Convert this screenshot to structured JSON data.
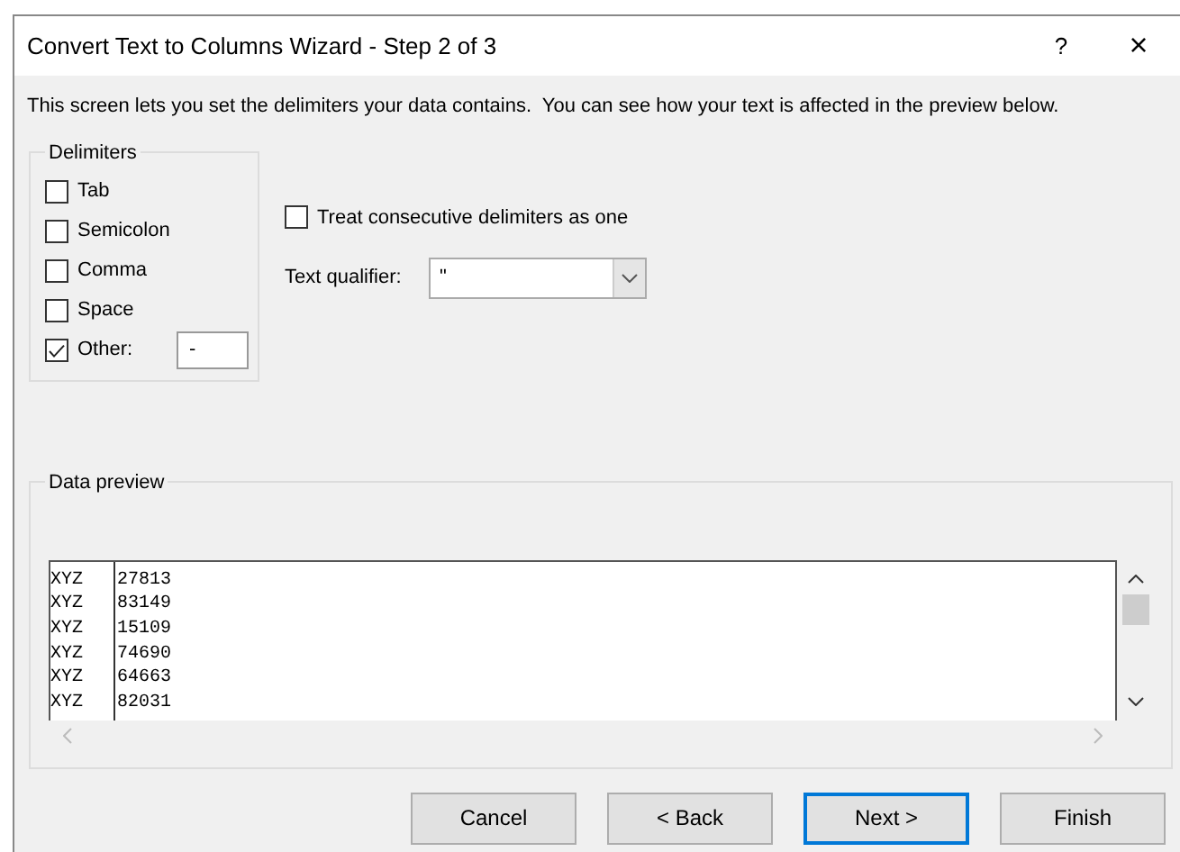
{
  "window": {
    "title": "Convert Text to Columns Wizard - Step 2 of 3",
    "help": "?",
    "close": "×"
  },
  "description": "This screen lets you set the delimiters your data contains.  You can see how your text is affected in the preview below.",
  "delimiters": {
    "label": "Delimiters",
    "items": [
      {
        "label": "Tab",
        "checked": false
      },
      {
        "label": "Semicolon",
        "checked": false
      },
      {
        "label": "Comma",
        "checked": false
      },
      {
        "label": "Space",
        "checked": false
      },
      {
        "label": "Other:",
        "checked": true
      }
    ],
    "other_value": "-"
  },
  "treat_consecutive": {
    "label": "Treat consecutive delimiters as one",
    "checked": false
  },
  "text_qualifier": {
    "label": "Text qualifier:",
    "value": "\""
  },
  "data_preview": {
    "label": "Data preview",
    "rows": [
      [
        "XYZ",
        "27813"
      ],
      [
        "XYZ",
        "83149"
      ],
      [
        "XYZ",
        "15109"
      ],
      [
        "XYZ",
        "74690"
      ],
      [
        "XYZ",
        "64663"
      ],
      [
        "XYZ",
        "82031"
      ]
    ]
  },
  "buttons": [
    {
      "label": "Cancel",
      "default": false
    },
    {
      "label": "< Back",
      "default": false
    },
    {
      "label": "Next >",
      "default": true
    },
    {
      "label": "Finish",
      "default": false
    }
  ]
}
